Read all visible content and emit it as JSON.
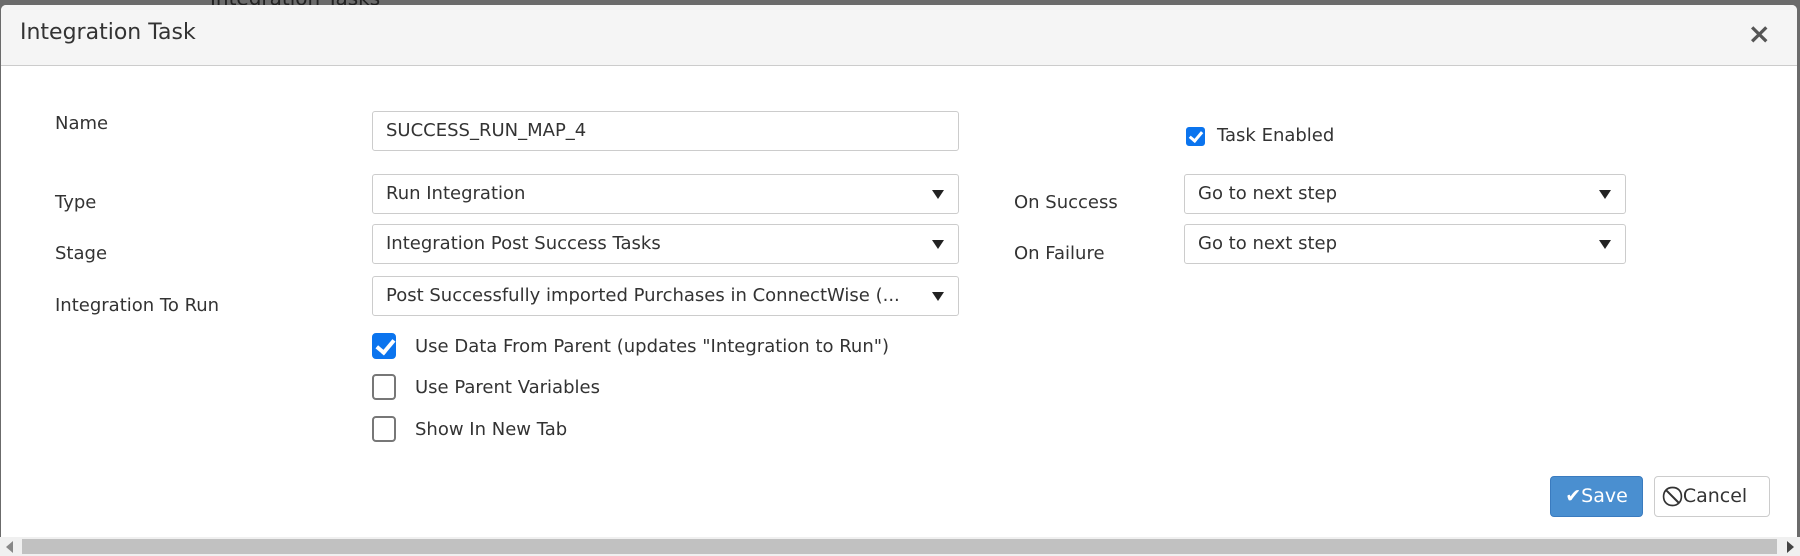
{
  "background": {
    "text": "Integration Tasks"
  },
  "dialog": {
    "title": "Integration Task",
    "close": "×"
  },
  "form": {
    "name_label": "Name",
    "name_value": "SUCCESS_RUN_MAP_4",
    "type_label": "Type",
    "type_value": "Run Integration",
    "stage_label": "Stage",
    "stage_value": "Integration Post Success Tasks",
    "integration_label": "Integration To Run",
    "integration_value": "Post Successfully imported Purchases in ConnectWise (...",
    "task_enabled_label": "Task Enabled",
    "task_enabled": true,
    "on_success_label": "On Success",
    "on_success_value": "Go to next step",
    "on_failure_label": "On Failure",
    "on_failure_value": "Go to next step",
    "checkboxes": [
      {
        "label": "Use Data From Parent (updates \"Integration to Run\")",
        "checked": true
      },
      {
        "label": "Use Parent Variables",
        "checked": false
      },
      {
        "label": "Show In New Tab",
        "checked": false
      }
    ]
  },
  "footer": {
    "save": "Save",
    "cancel": "Cancel"
  },
  "colors": {
    "primary": "#4a8fd0",
    "checkbox": "#0b74ee"
  }
}
